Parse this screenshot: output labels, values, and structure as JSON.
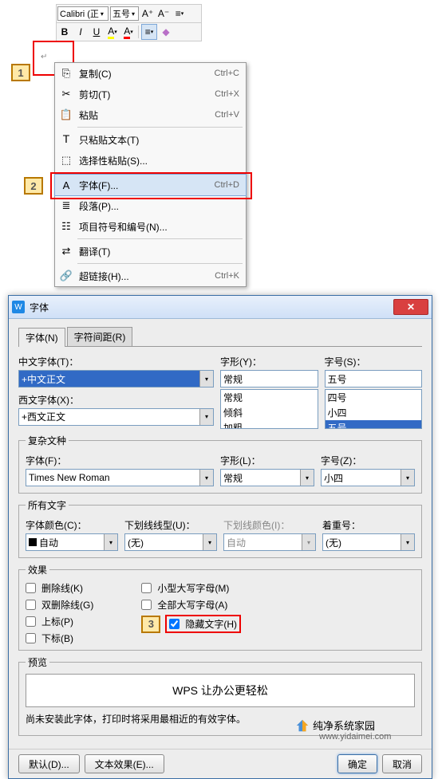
{
  "toolbar": {
    "font_name": "Calibri (正",
    "font_size": "五号",
    "bold": "B",
    "italic": "I",
    "underline": "U"
  },
  "badges": {
    "b1": "1",
    "b2": "2",
    "b3": "3"
  },
  "context_menu": [
    {
      "icon": "⎘",
      "label": "复制(C)",
      "shortcut": "Ctrl+C"
    },
    {
      "icon": "✂",
      "label": "剪切(T)",
      "shortcut": "Ctrl+X"
    },
    {
      "icon": "📋",
      "label": "粘贴",
      "shortcut": "Ctrl+V"
    },
    {
      "sep": true
    },
    {
      "icon": "𝖳",
      "label": "只粘贴文本(T)",
      "shortcut": ""
    },
    {
      "icon": "⬚",
      "label": "选择性粘贴(S)...",
      "shortcut": ""
    },
    {
      "sep": true
    },
    {
      "icon": "A",
      "label": "字体(F)...",
      "shortcut": "Ctrl+D",
      "hl": true
    },
    {
      "icon": "≣",
      "label": "段落(P)...",
      "shortcut": ""
    },
    {
      "icon": "☷",
      "label": "项目符号和编号(N)...",
      "shortcut": ""
    },
    {
      "sep": true
    },
    {
      "icon": "⇄",
      "label": "翻译(T)",
      "shortcut": ""
    },
    {
      "sep": true
    },
    {
      "icon": "🔗",
      "label": "超链接(H)...",
      "shortcut": "Ctrl+K"
    }
  ],
  "dialog": {
    "title": "字体",
    "tabs": [
      "字体(N)",
      "字符间距(R)"
    ],
    "labels": {
      "cn_font": "中文字体(T)：",
      "style": "字形(Y)：",
      "size": "字号(S)：",
      "en_font": "西文字体(X)：",
      "complex_legend": "复杂文种",
      "c_font": "字体(F)：",
      "c_style": "字形(L)：",
      "c_size": "字号(Z)：",
      "all_legend": "所有文字",
      "font_color": "字体颜色(C)：",
      "u_style": "下划线线型(U)：",
      "u_color": "下划线颜色(I)：",
      "emphasis": "着重号：",
      "effects_legend": "效果",
      "preview_legend": "预览"
    },
    "values": {
      "cn_font": "+中文正文",
      "style": "常规",
      "size": "五号",
      "en_font": "+西文正文",
      "style_opts": [
        "常规",
        "倾斜",
        "加粗"
      ],
      "size_opts": [
        "四号",
        "小四",
        "五号"
      ],
      "c_font": "Times New Roman",
      "c_style": "常规",
      "c_size": "小四",
      "font_color": "自动",
      "u_style": "(无)",
      "u_color": "自动",
      "emphasis": "(无)"
    },
    "effects": {
      "strike": "删除线(K)",
      "dstrike": "双删除线(G)",
      "super": "上标(P)",
      "sub": "下标(B)",
      "smallcaps": "小型大写字母(M)",
      "allcaps": "全部大写字母(A)",
      "hidden": "隐藏文字(H)"
    },
    "preview_text": "WPS 让办公更轻松",
    "note": "尚未安装此字体，打印时将采用最相近的有效字体。",
    "buttons": {
      "default": "默认(D)...",
      "texteff": "文本效果(E)...",
      "ok": "确定",
      "cancel": "取消"
    }
  },
  "watermarks": {
    "w1": "纯净系统家园",
    "w2": "www.yidaimei.com"
  }
}
